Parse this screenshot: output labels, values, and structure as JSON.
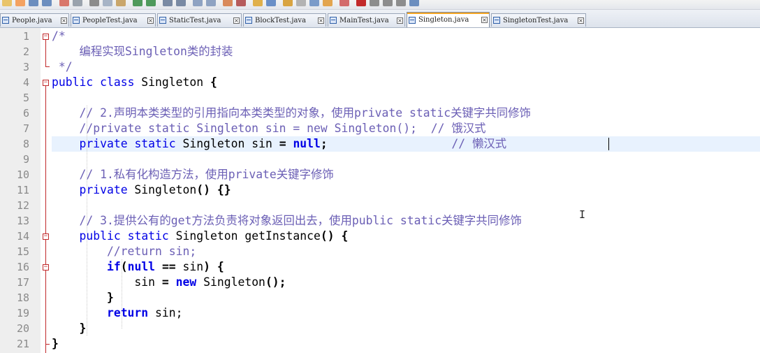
{
  "tabs": [
    {
      "label": "People.java",
      "active": false
    },
    {
      "label": "PeopleTest.java",
      "active": false
    },
    {
      "label": "StaticTest.java",
      "active": false
    },
    {
      "label": "BlockTest.java",
      "active": false
    },
    {
      "label": "MainTest.java",
      "active": false
    },
    {
      "label": "Singleton.java",
      "active": true
    },
    {
      "label": "SingletonTest.java",
      "active": false
    }
  ],
  "close_glyph": "×",
  "editor": {
    "current_line": 8,
    "lines": [
      {
        "n": "1",
        "tokens": [
          {
            "t": "/*",
            "c": "cm"
          }
        ]
      },
      {
        "n": "2",
        "tokens": [
          {
            "t": "    编程实现Singleton类的封装",
            "c": "cm"
          }
        ]
      },
      {
        "n": "3",
        "tokens": [
          {
            "t": " */",
            "c": "cm"
          }
        ]
      },
      {
        "n": "4",
        "tokens": [
          {
            "t": "public",
            "c": "kw"
          },
          {
            "t": " "
          },
          {
            "t": "class",
            "c": "kw"
          },
          {
            "t": " Singleton "
          },
          {
            "t": "{",
            "c": "op"
          }
        ]
      },
      {
        "n": "5",
        "tokens": []
      },
      {
        "n": "6",
        "tokens": [
          {
            "t": "    // 2.声明本类类型的引用指向本类类型的对象，使用private static关键字共同修饰",
            "c": "cm"
          }
        ]
      },
      {
        "n": "7",
        "tokens": [
          {
            "t": "    //private static Singleton sin = new Singleton();  // 饿汉式",
            "c": "cm"
          }
        ]
      },
      {
        "n": "8",
        "tokens": [
          {
            "t": "    "
          },
          {
            "t": "private",
            "c": "kw"
          },
          {
            "t": " "
          },
          {
            "t": "static",
            "c": "kw"
          },
          {
            "t": " Singleton sin "
          },
          {
            "t": "=",
            "c": "op"
          },
          {
            "t": " "
          },
          {
            "t": "null",
            "c": "kwb"
          },
          {
            "t": ";",
            "c": "op"
          },
          {
            "t": "                  "
          },
          {
            "t": "// 懒汉式",
            "c": "cm"
          }
        ]
      },
      {
        "n": "9",
        "tokens": []
      },
      {
        "n": "10",
        "tokens": [
          {
            "t": "    // 1.私有化构造方法，使用private关键字修饰",
            "c": "cm"
          }
        ]
      },
      {
        "n": "11",
        "tokens": [
          {
            "t": "    "
          },
          {
            "t": "private",
            "c": "kw"
          },
          {
            "t": " Singleton"
          },
          {
            "t": "()",
            "c": "op"
          },
          {
            "t": " "
          },
          {
            "t": "{}",
            "c": "op"
          }
        ]
      },
      {
        "n": "12",
        "tokens": []
      },
      {
        "n": "13",
        "tokens": [
          {
            "t": "    // 3.提供公有的get方法负责将对象返回出去，使用public static关键字共同修饰",
            "c": "cm"
          }
        ]
      },
      {
        "n": "14",
        "tokens": [
          {
            "t": "    "
          },
          {
            "t": "public",
            "c": "kw"
          },
          {
            "t": " "
          },
          {
            "t": "static",
            "c": "kw"
          },
          {
            "t": " Singleton getInstance"
          },
          {
            "t": "()",
            "c": "op"
          },
          {
            "t": " "
          },
          {
            "t": "{",
            "c": "op"
          }
        ]
      },
      {
        "n": "15",
        "tokens": [
          {
            "t": "        //return sin;",
            "c": "cm"
          }
        ]
      },
      {
        "n": "16",
        "tokens": [
          {
            "t": "        "
          },
          {
            "t": "if",
            "c": "kwb"
          },
          {
            "t": "(",
            "c": "op"
          },
          {
            "t": "null",
            "c": "kwb"
          },
          {
            "t": " "
          },
          {
            "t": "==",
            "c": "op"
          },
          {
            "t": " sin"
          },
          {
            "t": ")",
            "c": "op"
          },
          {
            "t": " "
          },
          {
            "t": "{",
            "c": "op"
          }
        ]
      },
      {
        "n": "17",
        "tokens": [
          {
            "t": "            sin "
          },
          {
            "t": "=",
            "c": "op"
          },
          {
            "t": " "
          },
          {
            "t": "new",
            "c": "kwb"
          },
          {
            "t": " Singleton"
          },
          {
            "t": "();",
            "c": "op"
          }
        ]
      },
      {
        "n": "18",
        "tokens": [
          {
            "t": "        "
          },
          {
            "t": "}",
            "c": "op"
          }
        ]
      },
      {
        "n": "19",
        "tokens": [
          {
            "t": "        "
          },
          {
            "t": "return",
            "c": "kwb"
          },
          {
            "t": " sin;"
          }
        ]
      },
      {
        "n": "20",
        "tokens": [
          {
            "t": "    "
          },
          {
            "t": "}",
            "c": "op"
          }
        ]
      },
      {
        "n": "21",
        "tokens": [
          {
            "t": "}",
            "c": "op"
          }
        ]
      }
    ]
  }
}
